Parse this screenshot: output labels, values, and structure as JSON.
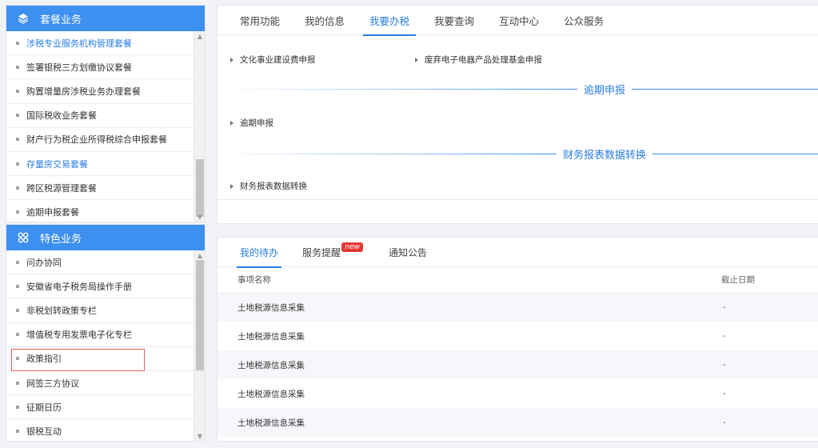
{
  "packages": {
    "title": "套餐业务",
    "icon": "layers-icon",
    "items": [
      {
        "label": "涉税专业服务机构管理套餐",
        "highlight": true
      },
      {
        "label": "签署银税三方划缴协议套餐",
        "highlight": false
      },
      {
        "label": "购置增量房涉税业务办理套餐",
        "highlight": false
      },
      {
        "label": "国际税收业务套餐",
        "highlight": false
      },
      {
        "label": "财产行为税企业所得税综合申报套餐",
        "highlight": false
      },
      {
        "label": "存量房交易套餐",
        "highlight": true
      },
      {
        "label": "跨区税源管理套餐",
        "highlight": false
      },
      {
        "label": "逾期申报套餐",
        "highlight": false
      }
    ]
  },
  "features": {
    "title": "特色业务",
    "icon": "grid-icon",
    "items": [
      {
        "label": "问办协同"
      },
      {
        "label": "安徽省电子税务局操作手册"
      },
      {
        "label": "非税划转政策专栏"
      },
      {
        "label": "增值税专用发票电子化专栏"
      },
      {
        "label": "政策指引",
        "selected": true
      },
      {
        "label": "网签三方协议"
      },
      {
        "label": "征期日历"
      },
      {
        "label": "银税互动"
      }
    ]
  },
  "main_tabs": [
    {
      "label": "常用功能",
      "active": false
    },
    {
      "label": "我的信息",
      "active": false
    },
    {
      "label": "我要办税",
      "active": true
    },
    {
      "label": "我要查询",
      "active": false
    },
    {
      "label": "互动中心",
      "active": false
    },
    {
      "label": "公众服务",
      "active": false
    }
  ],
  "links": {
    "culture_fee": "文化事业建设费申报",
    "waste_fund": "废弃电子电器产品处理基金申报",
    "overdue_section": "逾期申报",
    "overdue_link": "逾期申报",
    "finance_section": "财务报表数据转换",
    "finance_link": "财务报表数据转换"
  },
  "bottom_tabs": [
    {
      "label": "我的待办",
      "active": true
    },
    {
      "label": "服务提醒",
      "active": false,
      "badge": "new"
    },
    {
      "label": "通知公告",
      "active": false
    }
  ],
  "todo_table": {
    "columns": [
      "事项名称",
      "截止日期"
    ],
    "rows": [
      [
        "土地税源信息采集",
        "-"
      ],
      [
        "土地税源信息采集",
        "-"
      ],
      [
        "土地税源信息采集",
        "-"
      ],
      [
        "土地税源信息采集",
        "-"
      ],
      [
        "土地税源信息采集",
        "-"
      ]
    ]
  },
  "colors": {
    "accent": "#3d8ff0",
    "active_text": "#2a7ee3",
    "badge": "#e53935",
    "selection_box": "#e8605a"
  }
}
